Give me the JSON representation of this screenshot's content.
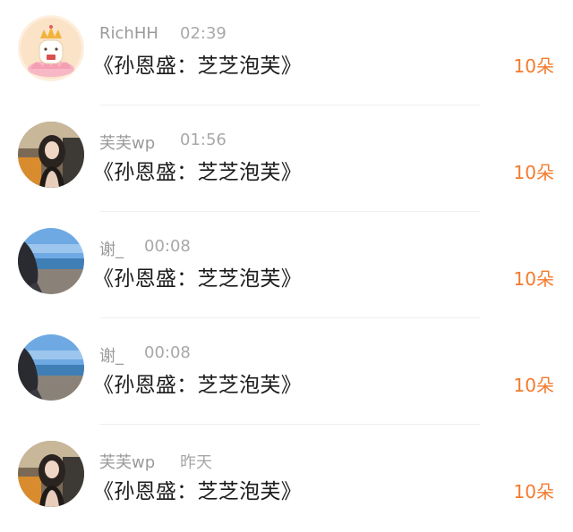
{
  "gift_list": [
    {
      "username": "RichHH",
      "time": "02:39",
      "gift": "《孙恩盛：芝芝泡芙》",
      "count": "10朵",
      "avatar": "cartoon-avatar"
    },
    {
      "username": "芙芙wp",
      "time": "01:56",
      "gift": "《孙恩盛：芝芝泡芙》",
      "count": "10朵",
      "avatar": "girl-photo-avatar"
    },
    {
      "username": "谢_",
      "time": "00:08",
      "gift": "《孙恩盛：芝芝泡芙》",
      "count": "10朵",
      "avatar": "beach-photo-avatar"
    },
    {
      "username": "谢_",
      "time": "00:08",
      "gift": "《孙恩盛：芝芝泡芙》",
      "count": "10朵",
      "avatar": "beach-photo-avatar"
    },
    {
      "username": "芙芙wp",
      "time": "昨天",
      "gift": "《孙恩盛：芝芝泡芙》",
      "count": "10朵",
      "avatar": "girl-photo-avatar"
    }
  ],
  "colors": {
    "count": "#f47a2c",
    "username": "#9a9a9a",
    "gift_text": "#1c1c1c"
  }
}
